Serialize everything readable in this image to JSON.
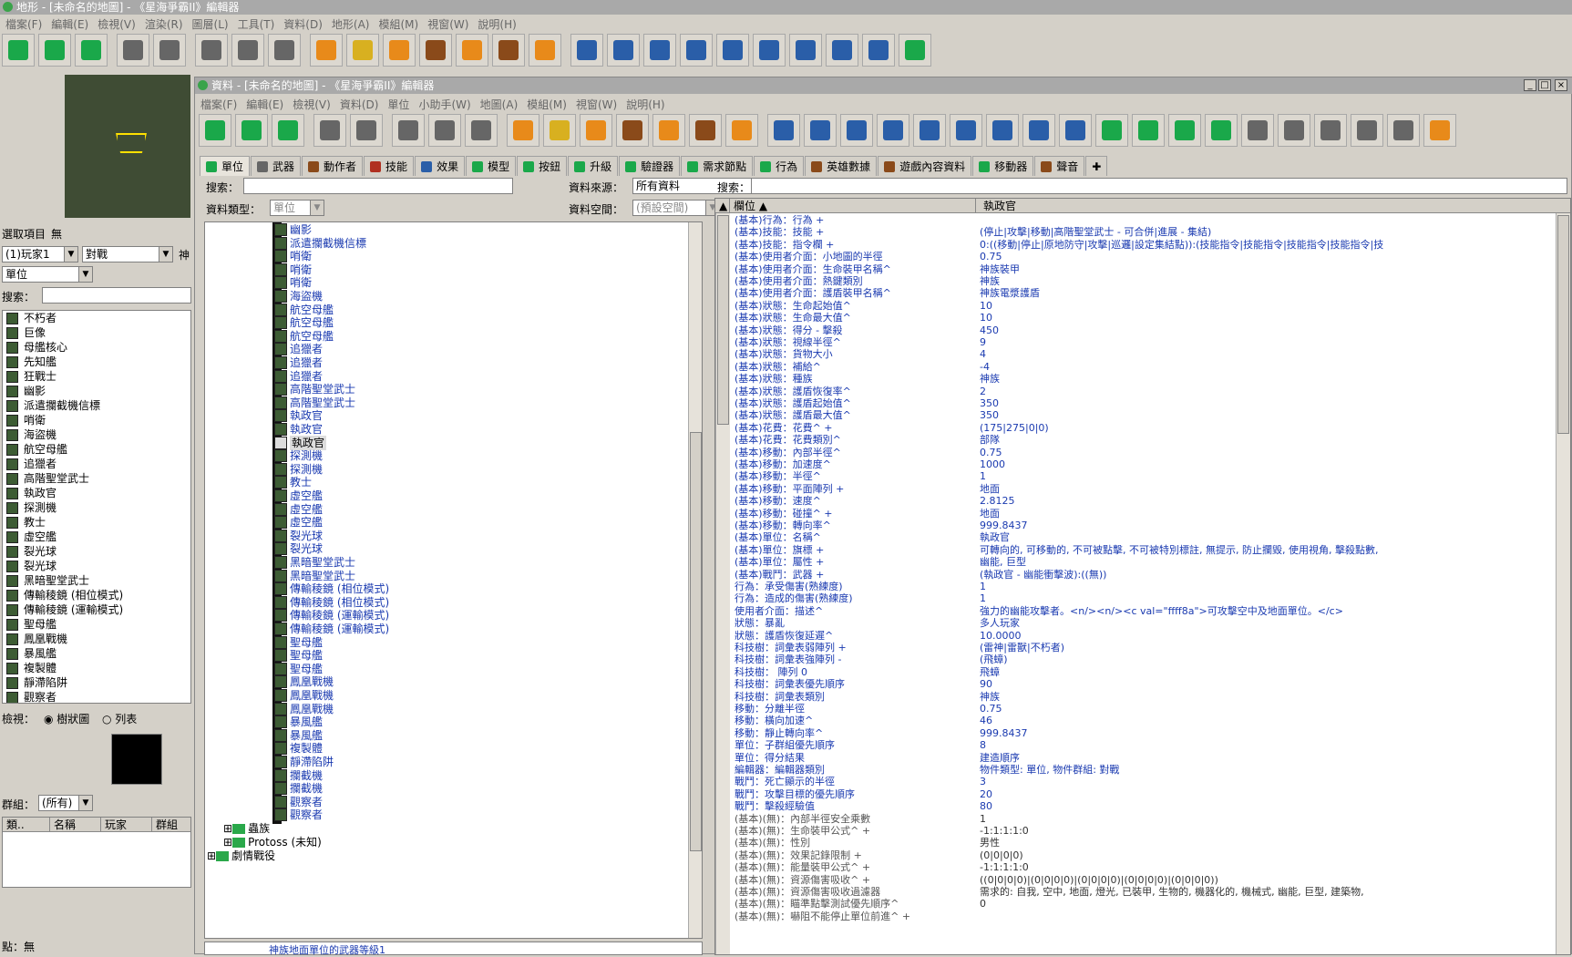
{
  "main_window": {
    "title": "地形 - [未命名的地圖] - 《星海爭霸II》編輯器",
    "menu": [
      "檔案(F)",
      "編輯(E)",
      "檢視(V)",
      "渲染(R)",
      "圖層(L)",
      "工具(T)",
      "資料(D)",
      "地形(A)",
      "模組(M)",
      "視窗(W)",
      "說明(H)"
    ]
  },
  "main_toolbar_icons": [
    "new-file-icon",
    "open-file-icon",
    "save-icon",
    "undo-icon",
    "redo-icon",
    "cut-icon",
    "copy-icon",
    "paste-icon",
    "terrain-icon",
    "units-icon",
    "doodads-icon",
    "points-icon",
    "regions-icon",
    "cameras-icon",
    "paths-icon",
    "data-icon",
    "triggers-icon",
    "ai-icon",
    "text-icon",
    "import-icon",
    "cutscene-icon",
    "ui-icon",
    "movie-icon",
    "lighting-icon",
    "sound-icon"
  ],
  "left": {
    "selection_label": "選取項目",
    "selection_value": "無",
    "player_combo": "(1)玩家1",
    "type_combo": "對戰",
    "extra": "神",
    "unit_combo": "單位",
    "search_label": "搜索：",
    "units": [
      "不朽者",
      "巨像",
      "母艦核心",
      "先知艦",
      "狂戰士",
      "幽影",
      "派遣攔截機信標",
      "哨衛",
      "海盜機",
      "航空母艦",
      "追獵者",
      "高階聖堂武士",
      "執政官",
      "探測機",
      "教士",
      "虛空艦",
      "裂光球",
      "裂光球",
      "黑暗聖堂武士",
      "傳輸稜鏡 (相位模式)",
      "傳輸稜鏡 (運輸模式)",
      "聖母艦",
      "鳳凰戰機",
      "暴風艦",
      "複製體",
      "靜滯陷阱",
      "觀察者"
    ],
    "view_label": "檢視：",
    "view_tree": "樹狀圖",
    "view_list": "列表",
    "group_label": "群組：",
    "group_value": "(所有)",
    "table_headers": [
      "類..",
      "名稱",
      "玩家",
      "群組"
    ],
    "status": "點：無"
  },
  "data_window": {
    "title": "資料 - [未命名的地圖] - 《星海爭霸II》編輯器",
    "menu": [
      "檔案(F)",
      "編輯(E)",
      "檢視(V)",
      "資料(D)",
      "單位",
      "小助手(W)",
      "地圖(A)",
      "模組(M)",
      "視窗(W)",
      "說明(H)"
    ],
    "tabs": [
      "單位",
      "武器",
      "動作者",
      "技能",
      "效果",
      "模型",
      "按鈕",
      "升級",
      "驗證器",
      "需求節點",
      "行為",
      "英雄數據",
      "遊戲內容資料",
      "移動器",
      "聲音"
    ],
    "search_label": "搜索：",
    "source_label": "資料來源：",
    "source_value": "所有資料",
    "type_label": "資料類型：",
    "type_value": "單位",
    "space_label": "資料空間：",
    "space_value": "(預設空間)",
    "tree_items": [
      "幽影",
      "派遣攔截機信標",
      "哨衛",
      "哨衛",
      "哨衛",
      "海盜機",
      "航空母艦",
      "航空母艦",
      "航空母艦",
      "追獵者",
      "追獵者",
      "追獵者",
      "高階聖堂武士",
      "高階聖堂武士",
      "執政官",
      "執政官",
      "執政官",
      "探測機",
      "探測機",
      "教士",
      "虛空艦",
      "虛空艦",
      "虛空艦",
      "裂光球",
      "裂光球",
      "黑暗聖堂武士",
      "黑暗聖堂武士",
      "傳輸稜鏡 (相位模式)",
      "傳輸稜鏡 (相位模式)",
      "傳輸稜鏡 (運輸模式)",
      "傳輸稜鏡 (運輸模式)",
      "聖母艦",
      "聖母艦",
      "聖母艦",
      "鳳凰戰機",
      "鳳凰戰機",
      "鳳凰戰機",
      "暴風艦",
      "暴風艦",
      "複製體",
      "靜滯陷阱",
      "攔截機",
      "攔截機",
      "觀察者",
      "觀察者"
    ],
    "tree_folders": [
      "蟲族",
      "Protoss (未知)",
      "劇情戰役"
    ],
    "bottom_item": "神族地面單位的武器等級1",
    "right_search_label": "搜索：",
    "grid_headers": [
      "欄位",
      "執政官"
    ],
    "rows": [
      [
        "(基本)行為：行為 +",
        ""
      ],
      [
        "(基本)技能：技能 +",
        "(停止|攻擊|移動|高階聖堂武士 - 可合併|進展 - 集結)"
      ],
      [
        "(基本)技能：指令欄 +",
        "0:((移動|停止|原地防守|攻擊|巡邏|設定集結點)):(技能指令|技能指令|技能指令|技能指令|技"
      ],
      [
        "(基本)使用者介面：小地圖的半徑",
        "0.75"
      ],
      [
        "(基本)使用者介面：生命裝甲名稱^",
        "神族裝甲"
      ],
      [
        "(基本)使用者介面：熱鍵類別",
        "神族"
      ],
      [
        "(基本)使用者介面：護盾裝甲名稱^",
        "神族電漿護盾"
      ],
      [
        "(基本)狀態：生命起始值^",
        "10"
      ],
      [
        "(基本)狀態：生命最大值^",
        "10"
      ],
      [
        "(基本)狀態：得分 - 擊殺",
        "450"
      ],
      [
        "(基本)狀態：視線半徑^",
        "9"
      ],
      [
        "(基本)狀態：貨物大小",
        "4"
      ],
      [
        "(基本)狀態：補給^",
        "-4"
      ],
      [
        "(基本)狀態：種族",
        "神族"
      ],
      [
        "(基本)狀態：護盾恢復率^",
        "2"
      ],
      [
        "(基本)狀態：護盾起始值^",
        "350"
      ],
      [
        "(基本)狀態：護盾最大值^",
        "350"
      ],
      [
        "(基本)花費：花費^ +",
        "(175|275|0|0)"
      ],
      [
        "(基本)花費：花費類別^",
        "部隊"
      ],
      [
        "(基本)移動：內部半徑^",
        "0.75"
      ],
      [
        "(基本)移動：加速度^",
        "1000"
      ],
      [
        "(基本)移動：半徑^",
        "1"
      ],
      [
        "(基本)移動：平面陣列 +",
        "地面"
      ],
      [
        "(基本)移動：速度^",
        "2.8125"
      ],
      [
        "(基本)移動：碰撞^ +",
        "地面"
      ],
      [
        "(基本)移動：轉向率^",
        "999.8437"
      ],
      [
        "(基本)單位：名稱^",
        "執政官"
      ],
      [
        "(基本)單位：旗標 +",
        "可轉向的, 可移動的, 不可被點擊, 不可被特別標註, 無提示, 防止攔毀, 使用視角, 擊殺點數,"
      ],
      [
        "(基本)單位：屬性 +",
        "幽能, 巨型"
      ],
      [
        "(基本)戰鬥：武器 +",
        "(執政官 - 幽能衝擊波):((無))"
      ],
      [
        "行為：承受傷害(熟練度)",
        "1"
      ],
      [
        "行為：造成的傷害(熟練度)",
        "1"
      ],
      [
        "使用者介面：描述^",
        "強力的幽能攻擊者。<n/><n/><c val=\"ffff8a\">可攻擊空中及地面單位。</c>"
      ],
      [
        "狀態：暴亂",
        "多人玩家"
      ],
      [
        "狀態：護盾恢復延遲^",
        "10.0000"
      ],
      [
        "科技樹：詞彙表弱陣列 +",
        "(雷神|雷獸|不朽者)"
      ],
      [
        "科技樹：詞彙表強陣列 -",
        "(飛蟑)"
      ],
      [
        "科技樹：   陣列 0",
        "飛蟑"
      ],
      [
        "科技樹：詞彙表優先順序",
        "90"
      ],
      [
        "科技樹：詞彙表類別",
        "神族"
      ],
      [
        "移動：分離半徑",
        "0.75"
      ],
      [
        "移動：橫向加速^",
        "46"
      ],
      [
        "移動：靜止轉向率^",
        "999.8437"
      ],
      [
        "單位：子群組優先順序",
        "8"
      ],
      [
        "單位：得分結果",
        "建造順序"
      ],
      [
        "編輯器：編輯器類別",
        "物件類型: 單位, 物件群組: 對戰"
      ],
      [
        "戰鬥：死亡顯示的半徑",
        "3"
      ],
      [
        "戰鬥：攻擊目標的優先順序",
        "20"
      ],
      [
        "戰鬥：擊殺經驗值",
        "80"
      ],
      [
        "(基本)(無)：內部半徑安全乘數",
        "1"
      ],
      [
        "(基本)(無)：生命裝甲公式^ +",
        "-1:1:1:1:0"
      ],
      [
        "(基本)(無)：性別",
        "男性"
      ],
      [
        "(基本)(無)：效果記錄限制 +",
        "(0|0|0|0)"
      ],
      [
        "(基本)(無)：能量裝甲公式^ +",
        "-1:1:1:1:0"
      ],
      [
        "(基本)(無)：資源傷害吸收^ +",
        "((0|0|0|0)|(0|0|0|0)|(0|0|0|0)|(0|0|0|0)|(0|0|0|0))"
      ],
      [
        "(基本)(無)：資源傷害吸收過濾器",
        "需求的: 自我, 空中, 地面, 燈光, 已裝甲, 生物的, 機器化的, 機械式, 幽能, 巨型, 建築物,"
      ],
      [
        "(基本)(無)：瞄準點擊測試優先順序^",
        "0"
      ],
      [
        "(基本)(無)：嚇阻不能停止單位前進^ +",
        ""
      ]
    ]
  }
}
